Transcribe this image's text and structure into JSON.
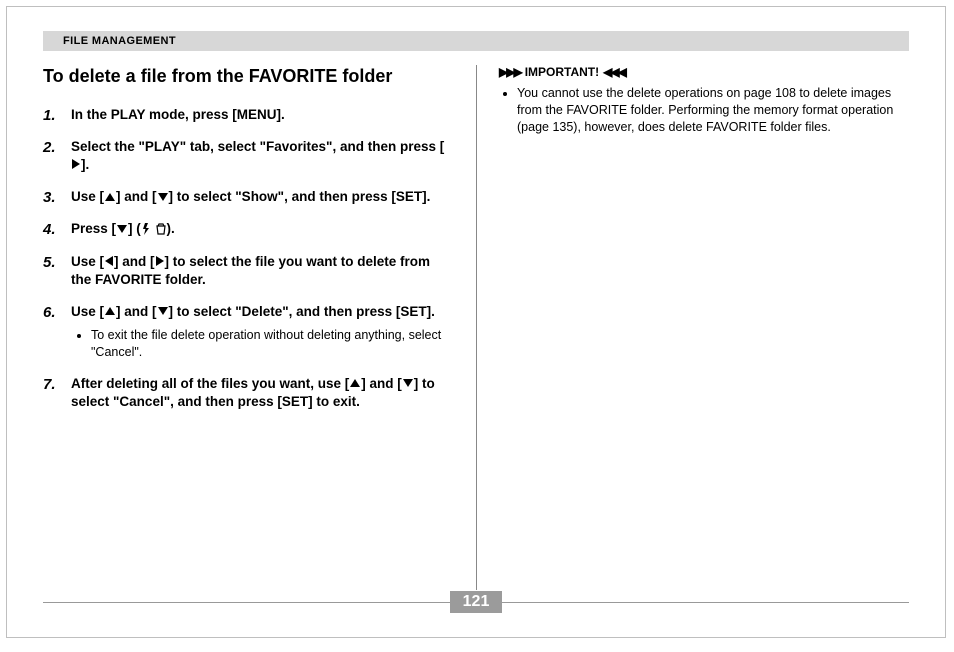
{
  "header": {
    "section": "FILE MANAGEMENT"
  },
  "left": {
    "title": "To delete a file from the FAVORITE folder",
    "steps": [
      {
        "pre": "In the PLAY mode, press [MENU]."
      },
      {
        "pre": "Select the \"PLAY\" tab, select \"Favorites\", and then press [",
        "sym1": "right",
        "post": "]."
      },
      {
        "pre": "Use [",
        "sym1": "up",
        "mid": "] and [",
        "sym2": "down",
        "post": "] to select \"Show\", and then press [SET]."
      },
      {
        "pre": "Press [",
        "sym1": "down",
        "mid": "] (",
        "sym2": "flash-trash",
        "post": ")."
      },
      {
        "pre": "Use [",
        "sym1": "left",
        "mid": "] and [",
        "sym2": "right",
        "post": "] to select the file you want to delete from the FAVORITE folder."
      },
      {
        "pre": "Use [",
        "sym1": "up",
        "mid": "] and [",
        "sym2": "down",
        "post": "] to select \"Delete\", and then press [SET].",
        "sub": [
          "To exit the file delete operation without deleting anything, select \"Cancel\"."
        ]
      },
      {
        "pre": "After deleting all of the files you want, use [",
        "sym1": "up",
        "mid": "] and [",
        "sym2": "down",
        "post": "] to select \"Cancel\", and then press [SET] to exit."
      }
    ]
  },
  "right": {
    "important_label": "IMPORTANT!",
    "items": [
      "You cannot use the delete operations on page 108 to delete images from the FAVORITE folder. Performing the memory format operation (page 135), however, does delete FAVORITE folder files."
    ]
  },
  "page_number": "121"
}
